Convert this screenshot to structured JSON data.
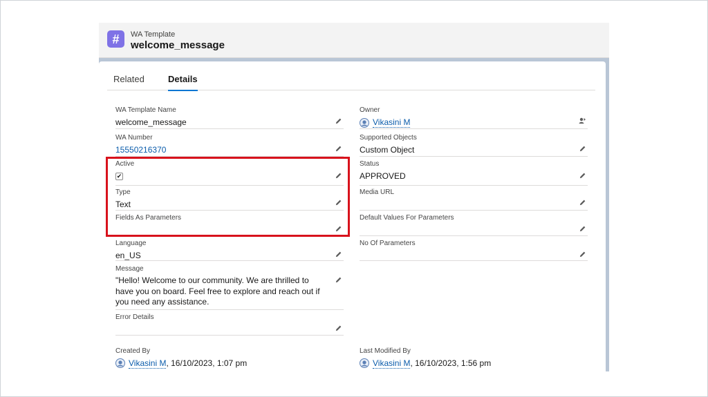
{
  "header": {
    "icon_glyph": "#",
    "object_type": "WA Template",
    "record_name": "welcome_message"
  },
  "tabs": [
    {
      "label": "Related",
      "active": false
    },
    {
      "label": "Details",
      "active": true
    }
  ],
  "fields_left": {
    "template_name": {
      "label": "WA Template Name",
      "value": "welcome_message"
    },
    "wa_number": {
      "label": "WA Number",
      "value": "15550216370"
    },
    "active": {
      "label": "Active",
      "checked": true,
      "check_glyph": "✔"
    },
    "type": {
      "label": "Type",
      "value": "Text"
    },
    "fields_as_parameters": {
      "label": "Fields As Parameters",
      "value": ""
    },
    "language": {
      "label": "Language",
      "value": "en_US"
    },
    "message": {
      "label": "Message",
      "value": "\"Hello! Welcome to our community. We are thrilled to have you on board. Feel free to explore and reach out if you need any assistance."
    },
    "error_details": {
      "label": "Error Details",
      "value": ""
    }
  },
  "fields_right": {
    "owner": {
      "label": "Owner",
      "value": "Vikasini M"
    },
    "supported_objects": {
      "label": "Supported Objects",
      "value": "Custom Object"
    },
    "status": {
      "label": "Status",
      "value": "APPROVED"
    },
    "media_url": {
      "label": "Media URL",
      "value": ""
    },
    "default_values": {
      "label": "Default Values For Parameters",
      "value": ""
    },
    "no_of_parameters": {
      "label": "No Of Parameters",
      "value": ""
    }
  },
  "audit": {
    "created_by": {
      "label": "Created By",
      "user": "Vikasini M",
      "timestamp": ", 16/10/2023, 1:07 pm"
    },
    "last_modified_by": {
      "label": "Last Modified By",
      "user": "Vikasini M",
      "timestamp": ", 16/10/2023, 1:56 pm"
    }
  },
  "colors": {
    "highlight": "#d8121c",
    "header_icon": "#7f72e6",
    "link": "#0b5cab",
    "tab_underline": "#0176d3"
  },
  "icons": {
    "edit": "pencil-icon",
    "change_owner": "change-owner-icon",
    "user": "user-avatar-icon"
  }
}
